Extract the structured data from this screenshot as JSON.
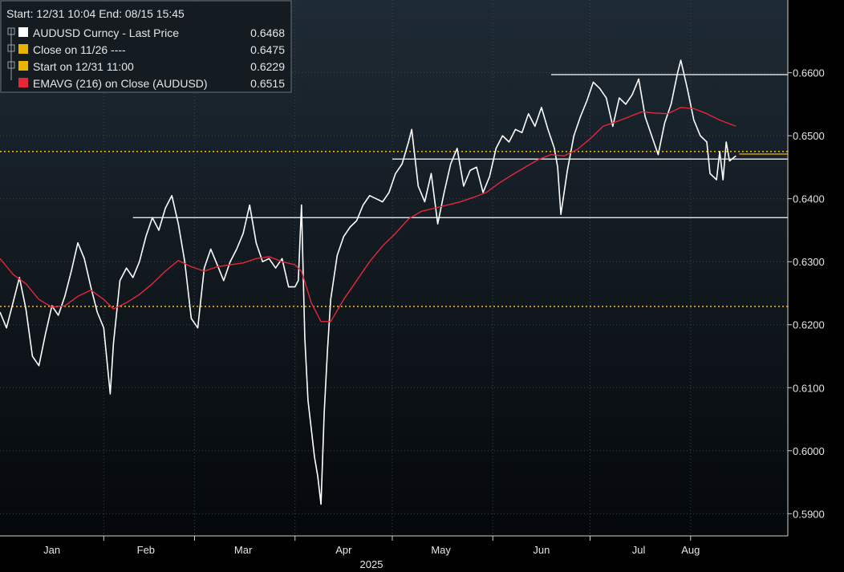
{
  "colors": {
    "background_top": "#1e2a34",
    "background_bottom": "#05080b",
    "price": "#ffffff",
    "ema": "#e8263a",
    "close_line": "#e8b400",
    "start_line": "#e8b400",
    "level_line": "#ffffff",
    "grid": "#3a4650"
  },
  "legend": {
    "header": "Start: 12/31 10:04 End: 08/15 15:45",
    "items": [
      {
        "label": "AUDUSD Curncy - Last Price",
        "value": "0.6468",
        "swatch": "#ffffff",
        "icon": "square-icon"
      },
      {
        "label": "Close on 11/26 ----",
        "value": "0.6475",
        "swatch": "#e8b400",
        "icon": "square-icon"
      },
      {
        "label": "Start on 12/31 11:00",
        "value": "0.6229",
        "swatch": "#e8b400",
        "icon": "square-icon"
      },
      {
        "label": "EMAVG (216)  on Close (AUDUSD)",
        "value": "0.6515",
        "swatch": "#e8263a",
        "icon": "square-icon"
      }
    ]
  },
  "chart_data": {
    "type": "line",
    "title": "",
    "xlabel": "",
    "ylabel": "",
    "year_label": "2025",
    "ylim": [
      0.588,
      0.669
    ],
    "y_ticks": [
      "0.5900",
      "0.6000",
      "0.6100",
      "0.6200",
      "0.6300",
      "0.6400",
      "0.6500",
      "0.6600"
    ],
    "y_tick_values": [
      0.59,
      0.6,
      0.61,
      0.62,
      0.63,
      0.64,
      0.65,
      0.66
    ],
    "x_start": "2024-12-31",
    "x_end": "2025-08-31",
    "month_labels": [
      {
        "label": "Jan",
        "date": "2025-01-16"
      },
      {
        "label": "Feb",
        "date": "2025-02-14"
      },
      {
        "label": "Mar",
        "date": "2025-03-16"
      },
      {
        "label": "Apr",
        "date": "2025-04-16"
      },
      {
        "label": "May",
        "date": "2025-05-16"
      },
      {
        "label": "Jun",
        "date": "2025-06-16"
      },
      {
        "label": "Jul",
        "date": "2025-07-16"
      },
      {
        "label": "Aug",
        "date": "2025-08-01"
      }
    ],
    "month_boundaries": [
      "2025-02-01",
      "2025-03-01",
      "2025-04-01",
      "2025-05-01",
      "2025-06-01",
      "2025-07-01",
      "2025-08-01"
    ],
    "series": [
      {
        "name": "AUDUSD Curncy - Last Price",
        "points": [
          [
            "2024-12-31",
            0.622
          ],
          [
            "2025-01-02",
            0.6195
          ],
          [
            "2025-01-04",
            0.6235
          ],
          [
            "2025-01-06",
            0.6275
          ],
          [
            "2025-01-08",
            0.6225
          ],
          [
            "2025-01-10",
            0.615
          ],
          [
            "2025-01-12",
            0.6135
          ],
          [
            "2025-01-14",
            0.6185
          ],
          [
            "2025-01-16",
            0.623
          ],
          [
            "2025-01-18",
            0.6215
          ],
          [
            "2025-01-20",
            0.6245
          ],
          [
            "2025-01-22",
            0.6285
          ],
          [
            "2025-01-24",
            0.633
          ],
          [
            "2025-01-26",
            0.6305
          ],
          [
            "2025-01-28",
            0.626
          ],
          [
            "2025-01-30",
            0.622
          ],
          [
            "2025-02-01",
            0.6195
          ],
          [
            "2025-02-03",
            0.609
          ],
          [
            "2025-02-04",
            0.617
          ],
          [
            "2025-02-06",
            0.627
          ],
          [
            "2025-02-08",
            0.629
          ],
          [
            "2025-02-10",
            0.6275
          ],
          [
            "2025-02-12",
            0.63
          ],
          [
            "2025-02-14",
            0.634
          ],
          [
            "2025-02-16",
            0.637
          ],
          [
            "2025-02-18",
            0.635
          ],
          [
            "2025-02-20",
            0.6385
          ],
          [
            "2025-02-22",
            0.6405
          ],
          [
            "2025-02-24",
            0.636
          ],
          [
            "2025-02-26",
            0.63
          ],
          [
            "2025-02-28",
            0.621
          ],
          [
            "2025-03-02",
            0.6195
          ],
          [
            "2025-03-04",
            0.629
          ],
          [
            "2025-03-06",
            0.632
          ],
          [
            "2025-03-08",
            0.6295
          ],
          [
            "2025-03-10",
            0.627
          ],
          [
            "2025-03-12",
            0.63
          ],
          [
            "2025-03-14",
            0.632
          ],
          [
            "2025-03-16",
            0.6345
          ],
          [
            "2025-03-18",
            0.639
          ],
          [
            "2025-03-20",
            0.633
          ],
          [
            "2025-03-22",
            0.63
          ],
          [
            "2025-03-24",
            0.6305
          ],
          [
            "2025-03-26",
            0.629
          ],
          [
            "2025-03-28",
            0.6305
          ],
          [
            "2025-03-30",
            0.626
          ],
          [
            "2025-04-01",
            0.626
          ],
          [
            "2025-04-02",
            0.627
          ],
          [
            "2025-04-03",
            0.639
          ],
          [
            "2025-04-04",
            0.618
          ],
          [
            "2025-04-05",
            0.608
          ],
          [
            "2025-04-07",
            0.599
          ],
          [
            "2025-04-08",
            0.596
          ],
          [
            "2025-04-09",
            0.5915
          ],
          [
            "2025-04-10",
            0.606
          ],
          [
            "2025-04-11",
            0.616
          ],
          [
            "2025-04-12",
            0.624
          ],
          [
            "2025-04-14",
            0.631
          ],
          [
            "2025-04-16",
            0.634
          ],
          [
            "2025-04-18",
            0.6355
          ],
          [
            "2025-04-20",
            0.6365
          ],
          [
            "2025-04-22",
            0.639
          ],
          [
            "2025-04-24",
            0.6405
          ],
          [
            "2025-04-26",
            0.64
          ],
          [
            "2025-04-28",
            0.6395
          ],
          [
            "2025-04-30",
            0.641
          ],
          [
            "2025-05-02",
            0.644
          ],
          [
            "2025-05-04",
            0.6455
          ],
          [
            "2025-05-06",
            0.649
          ],
          [
            "2025-05-07",
            0.651
          ],
          [
            "2025-05-09",
            0.642
          ],
          [
            "2025-05-11",
            0.6395
          ],
          [
            "2025-05-13",
            0.644
          ],
          [
            "2025-05-15",
            0.636
          ],
          [
            "2025-05-17",
            0.641
          ],
          [
            "2025-05-19",
            0.6455
          ],
          [
            "2025-05-21",
            0.648
          ],
          [
            "2025-05-23",
            0.642
          ],
          [
            "2025-05-25",
            0.6445
          ],
          [
            "2025-05-27",
            0.645
          ],
          [
            "2025-05-29",
            0.641
          ],
          [
            "2025-05-31",
            0.6435
          ],
          [
            "2025-06-02",
            0.648
          ],
          [
            "2025-06-04",
            0.65
          ],
          [
            "2025-06-06",
            0.649
          ],
          [
            "2025-06-08",
            0.651
          ],
          [
            "2025-06-10",
            0.6505
          ],
          [
            "2025-06-12",
            0.6535
          ],
          [
            "2025-06-14",
            0.6515
          ],
          [
            "2025-06-16",
            0.6545
          ],
          [
            "2025-06-18",
            0.651
          ],
          [
            "2025-06-20",
            0.648
          ],
          [
            "2025-06-21",
            0.645
          ],
          [
            "2025-06-22",
            0.6375
          ],
          [
            "2025-06-24",
            0.6445
          ],
          [
            "2025-06-26",
            0.65
          ],
          [
            "2025-06-28",
            0.653
          ],
          [
            "2025-06-30",
            0.6555
          ],
          [
            "2025-07-02",
            0.6585
          ],
          [
            "2025-07-04",
            0.6575
          ],
          [
            "2025-07-06",
            0.656
          ],
          [
            "2025-07-08",
            0.6515
          ],
          [
            "2025-07-10",
            0.656
          ],
          [
            "2025-07-12",
            0.655
          ],
          [
            "2025-07-14",
            0.6565
          ],
          [
            "2025-07-16",
            0.659
          ],
          [
            "2025-07-18",
            0.653
          ],
          [
            "2025-07-20",
            0.65
          ],
          [
            "2025-07-22",
            0.647
          ],
          [
            "2025-07-24",
            0.652
          ],
          [
            "2025-07-26",
            0.655
          ],
          [
            "2025-07-28",
            0.66
          ],
          [
            "2025-07-29",
            0.662
          ],
          [
            "2025-07-31",
            0.6575
          ],
          [
            "2025-08-02",
            0.6525
          ],
          [
            "2025-08-04",
            0.65
          ],
          [
            "2025-08-06",
            0.649
          ],
          [
            "2025-08-07",
            0.644
          ],
          [
            "2025-08-09",
            0.643
          ],
          [
            "2025-08-10",
            0.6475
          ],
          [
            "2025-08-11",
            0.643
          ],
          [
            "2025-08-12",
            0.649
          ],
          [
            "2025-08-13",
            0.646
          ],
          [
            "2025-08-15",
            0.6468
          ]
        ]
      },
      {
        "name": "EMAVG (216)  on Close (AUDUSD)",
        "points": [
          [
            "2024-12-31",
            0.6305
          ],
          [
            "2025-01-04",
            0.628
          ],
          [
            "2025-01-08",
            0.6265
          ],
          [
            "2025-01-12",
            0.624
          ],
          [
            "2025-01-16",
            0.6228
          ],
          [
            "2025-01-20",
            0.623
          ],
          [
            "2025-01-24",
            0.6245
          ],
          [
            "2025-01-28",
            0.6255
          ],
          [
            "2025-02-01",
            0.624
          ],
          [
            "2025-02-04",
            0.6225
          ],
          [
            "2025-02-08",
            0.6235
          ],
          [
            "2025-02-12",
            0.6248
          ],
          [
            "2025-02-16",
            0.6265
          ],
          [
            "2025-02-20",
            0.6285
          ],
          [
            "2025-02-24",
            0.6302
          ],
          [
            "2025-02-28",
            0.6292
          ],
          [
            "2025-03-04",
            0.6285
          ],
          [
            "2025-03-08",
            0.6292
          ],
          [
            "2025-03-12",
            0.6295
          ],
          [
            "2025-03-16",
            0.6298
          ],
          [
            "2025-03-20",
            0.6305
          ],
          [
            "2025-03-24",
            0.6308
          ],
          [
            "2025-03-28",
            0.63
          ],
          [
            "2025-04-01",
            0.6295
          ],
          [
            "2025-04-03",
            0.6285
          ],
          [
            "2025-04-06",
            0.6235
          ],
          [
            "2025-04-09",
            0.6205
          ],
          [
            "2025-04-12",
            0.6205
          ],
          [
            "2025-04-16",
            0.624
          ],
          [
            "2025-04-20",
            0.627
          ],
          [
            "2025-04-24",
            0.63
          ],
          [
            "2025-04-28",
            0.6325
          ],
          [
            "2025-05-02",
            0.6345
          ],
          [
            "2025-05-06",
            0.6368
          ],
          [
            "2025-05-10",
            0.638
          ],
          [
            "2025-05-14",
            0.6385
          ],
          [
            "2025-05-18",
            0.639
          ],
          [
            "2025-05-22",
            0.6395
          ],
          [
            "2025-05-26",
            0.6402
          ],
          [
            "2025-05-30",
            0.641
          ],
          [
            "2025-06-03",
            0.6425
          ],
          [
            "2025-06-07",
            0.6438
          ],
          [
            "2025-06-11",
            0.645
          ],
          [
            "2025-06-15",
            0.6462
          ],
          [
            "2025-06-19",
            0.647
          ],
          [
            "2025-06-23",
            0.6468
          ],
          [
            "2025-06-27",
            0.6478
          ],
          [
            "2025-07-01",
            0.6495
          ],
          [
            "2025-07-05",
            0.6515
          ],
          [
            "2025-07-09",
            0.6522
          ],
          [
            "2025-07-13",
            0.653
          ],
          [
            "2025-07-17",
            0.6538
          ],
          [
            "2025-07-21",
            0.6536
          ],
          [
            "2025-07-25",
            0.6535
          ],
          [
            "2025-07-29",
            0.6545
          ],
          [
            "2025-08-02",
            0.6543
          ],
          [
            "2025-08-06",
            0.6535
          ],
          [
            "2025-08-10",
            0.6525
          ],
          [
            "2025-08-15",
            0.6515
          ]
        ]
      }
    ],
    "reference_lines": [
      {
        "name": "Close on 11/26",
        "value": 0.6475,
        "style": "dotted"
      },
      {
        "name": "Start on 12/31 11:00",
        "value": 0.6229,
        "style": "dotted"
      }
    ],
    "level_lines": [
      {
        "value": 0.637,
        "from": "2025-02-10",
        "to": "2025-08-31"
      },
      {
        "value": 0.6463,
        "from": "2025-05-01",
        "to": "2025-08-31"
      },
      {
        "value": 0.6597,
        "from": "2025-06-19",
        "to": "2025-08-31"
      }
    ],
    "last_value_tag": {
      "value": 0.6469,
      "from": "2025-08-16",
      "to": "2025-08-31"
    },
    "grid": true,
    "legend_position": "top-left"
  }
}
